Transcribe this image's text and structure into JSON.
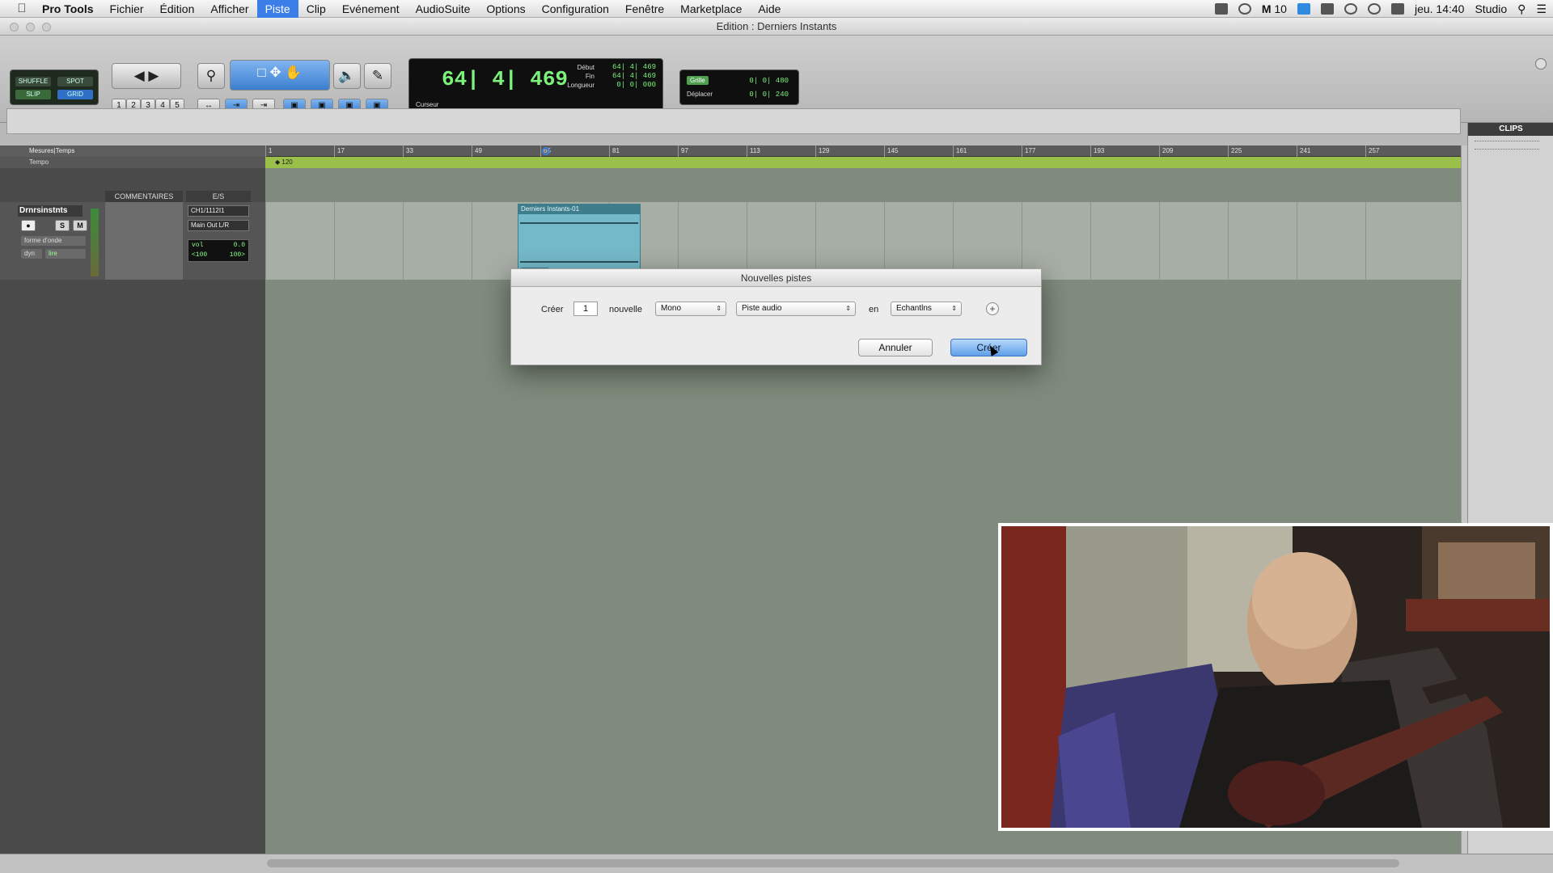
{
  "menubar": {
    "apple": "",
    "app_name": "Pro Tools",
    "items": [
      "Fichier",
      "Édition",
      "Afficher",
      "Piste",
      "Clip",
      "Evénement",
      "AudioSuite",
      "Options",
      "Configuration",
      "Fenêtre",
      "Marketplace",
      "Aide"
    ],
    "active_item": "Piste",
    "status_number": "10",
    "clock": "jeu. 14:40",
    "user": "Studio"
  },
  "window": {
    "title": "Edition : Derniers Instants"
  },
  "toolbar": {
    "modes": [
      "SHUFFLE",
      "SPOT",
      "SLIP",
      "GRID"
    ],
    "numbers": [
      "1",
      "2",
      "3",
      "4",
      "5"
    ],
    "counter_main": "64| 4| 469",
    "counter_labels": [
      "Début",
      "Fin",
      "Longueur"
    ],
    "counter_values": [
      "64| 4| 469",
      "64| 4| 469",
      "0| 0| 000"
    ],
    "counter_cursor_label": "Curseur",
    "grid_label": "Grille",
    "grid_value": "0| 0| 480",
    "nudge_label": "Déplacer",
    "nudge_value": "0| 0| 240"
  },
  "ruler": {
    "label": "Mesures|Temps",
    "tempo_label": "Tempo",
    "tempo_value": "120",
    "ticks": [
      "1",
      "17",
      "33",
      "49",
      "65",
      "81",
      "97",
      "113",
      "129",
      "145",
      "161",
      "177",
      "193",
      "209",
      "225",
      "241",
      "257"
    ]
  },
  "tracklist": {
    "columns": [
      "COMMENTAIRES",
      "E/S"
    ],
    "track": {
      "name": "Drnrsinstnts",
      "buttons": [
        "S",
        "M"
      ],
      "view": "forme d'onde",
      "dyn": "dyn",
      "lire": "lire",
      "input": "CH1/1112I1",
      "output": "Main Out L/R",
      "vol_label": "vol",
      "vol_value": "0.0",
      "pan_left": "<100",
      "pan_right": "100>"
    }
  },
  "clip": {
    "name": "Derniers Instants-01"
  },
  "clips_panel": {
    "title": "CLIPS"
  },
  "dialog": {
    "title": "Nouvelles pistes",
    "create_label": "Créer",
    "count": "1",
    "nouvelle_label": "nouvelle",
    "format_value": "Mono",
    "type_value": "Piste audio",
    "en_label": "en",
    "timebase_value": "Echantlns",
    "cancel_button": "Annuler",
    "ok_button": "Créer"
  }
}
